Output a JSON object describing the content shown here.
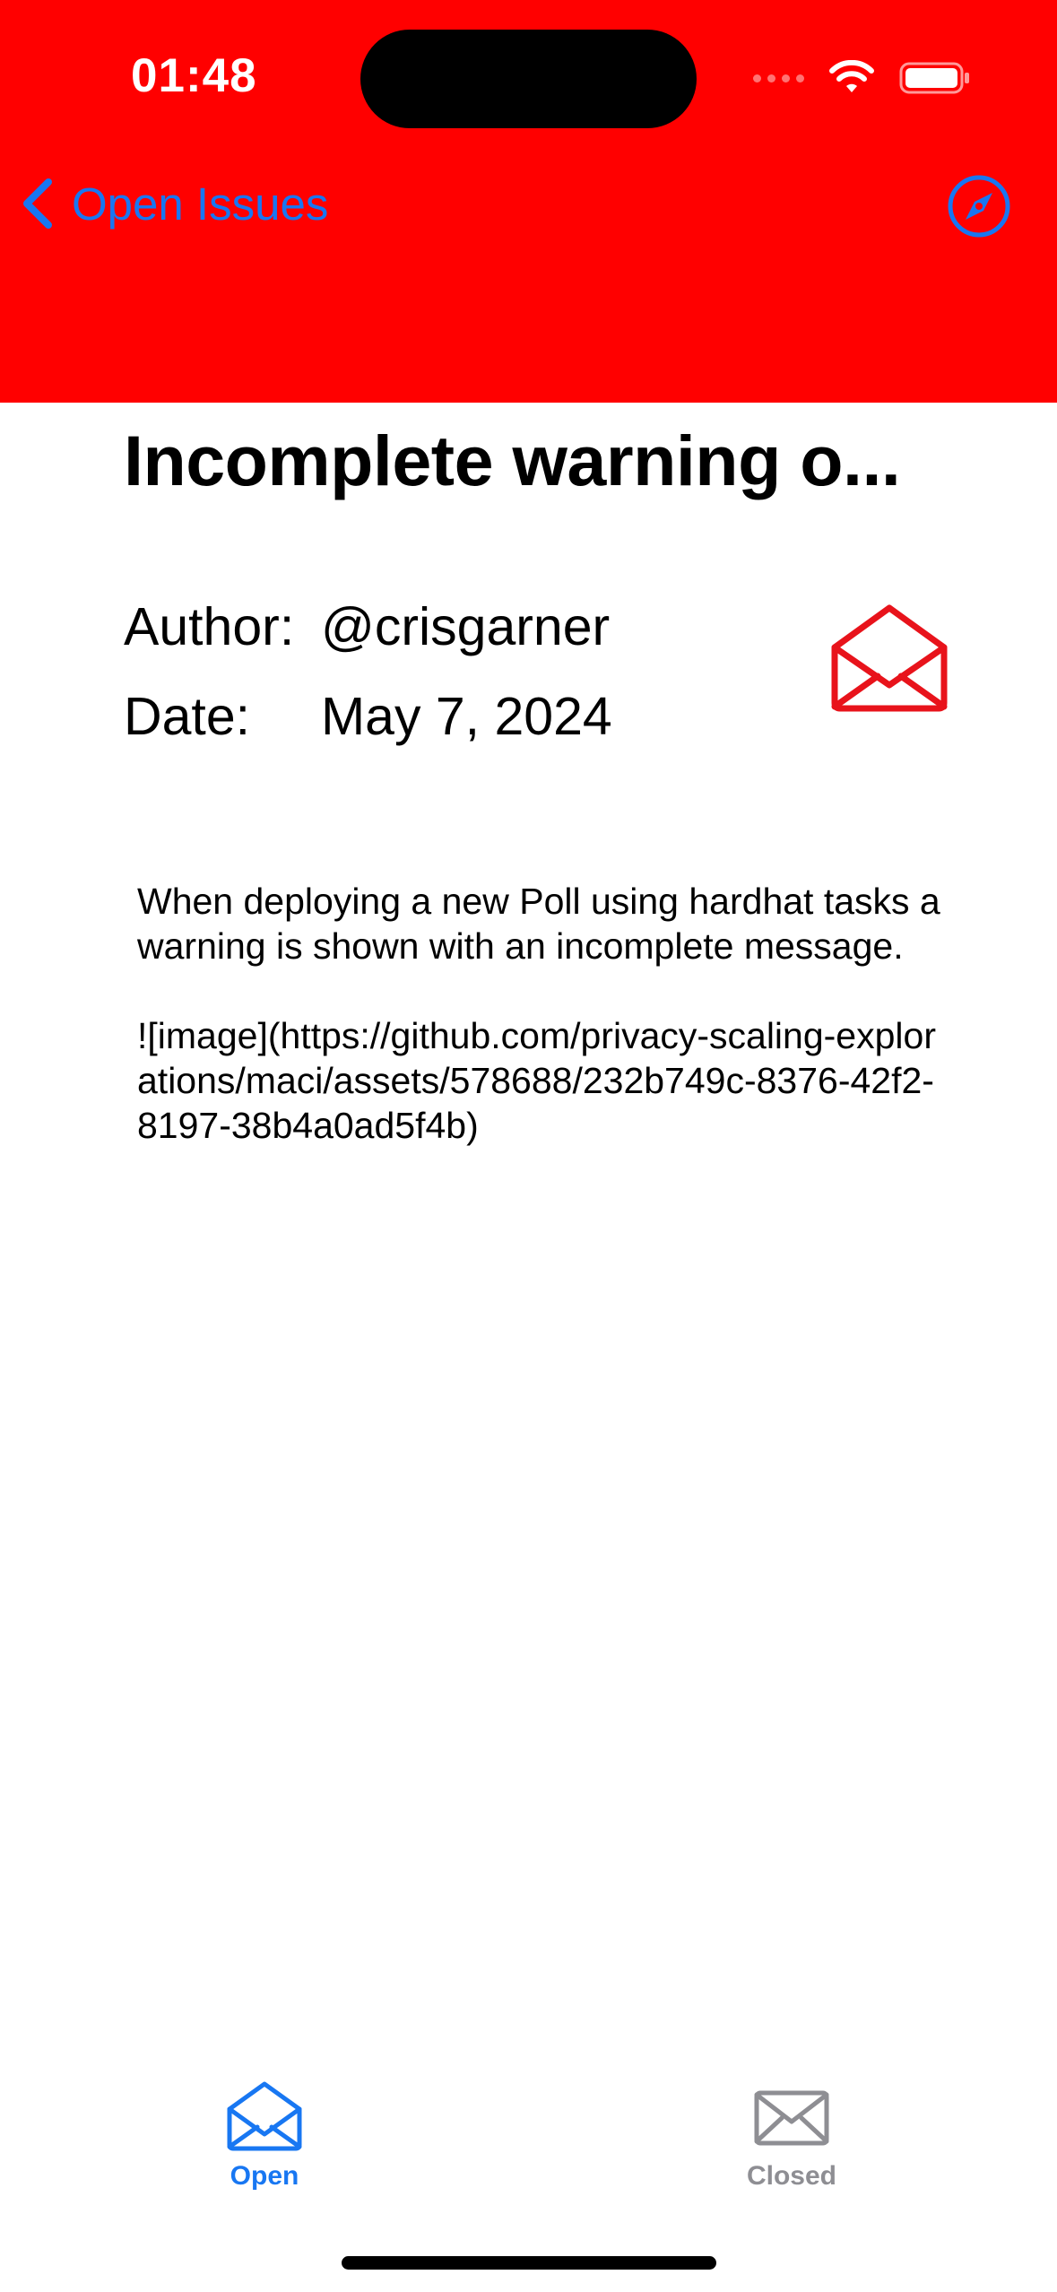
{
  "status_bar": {
    "time": "01:48"
  },
  "nav": {
    "back_label": "Open Issues",
    "back_icon": "chevron-left-icon",
    "right_icon": "safari-compass-icon"
  },
  "issue": {
    "title": "Incomplete warning o...",
    "author_label": "Author:",
    "author_value": "@crisgarner",
    "date_label": "Date:",
    "date_value": "May 7, 2024",
    "status_icon": "envelope-open-icon",
    "body": "When deploying a new Poll using hardhat tasks a warning is shown with an incomplete message.\n\n![image](https://github.com/privacy-scaling-explorations/maci/assets/578688/232b749c-8376-42f2-8197-38b4a0ad5f4b)"
  },
  "tabs": [
    {
      "label": "Open",
      "icon": "envelope-open-icon",
      "selected": true
    },
    {
      "label": "Closed",
      "icon": "envelope-closed-icon",
      "selected": false
    }
  ],
  "colors": {
    "header_bg": "#ff0000",
    "accent": "#1877f2",
    "status_icon": "#e8131b",
    "inactive_tab": "#8e8e93"
  }
}
